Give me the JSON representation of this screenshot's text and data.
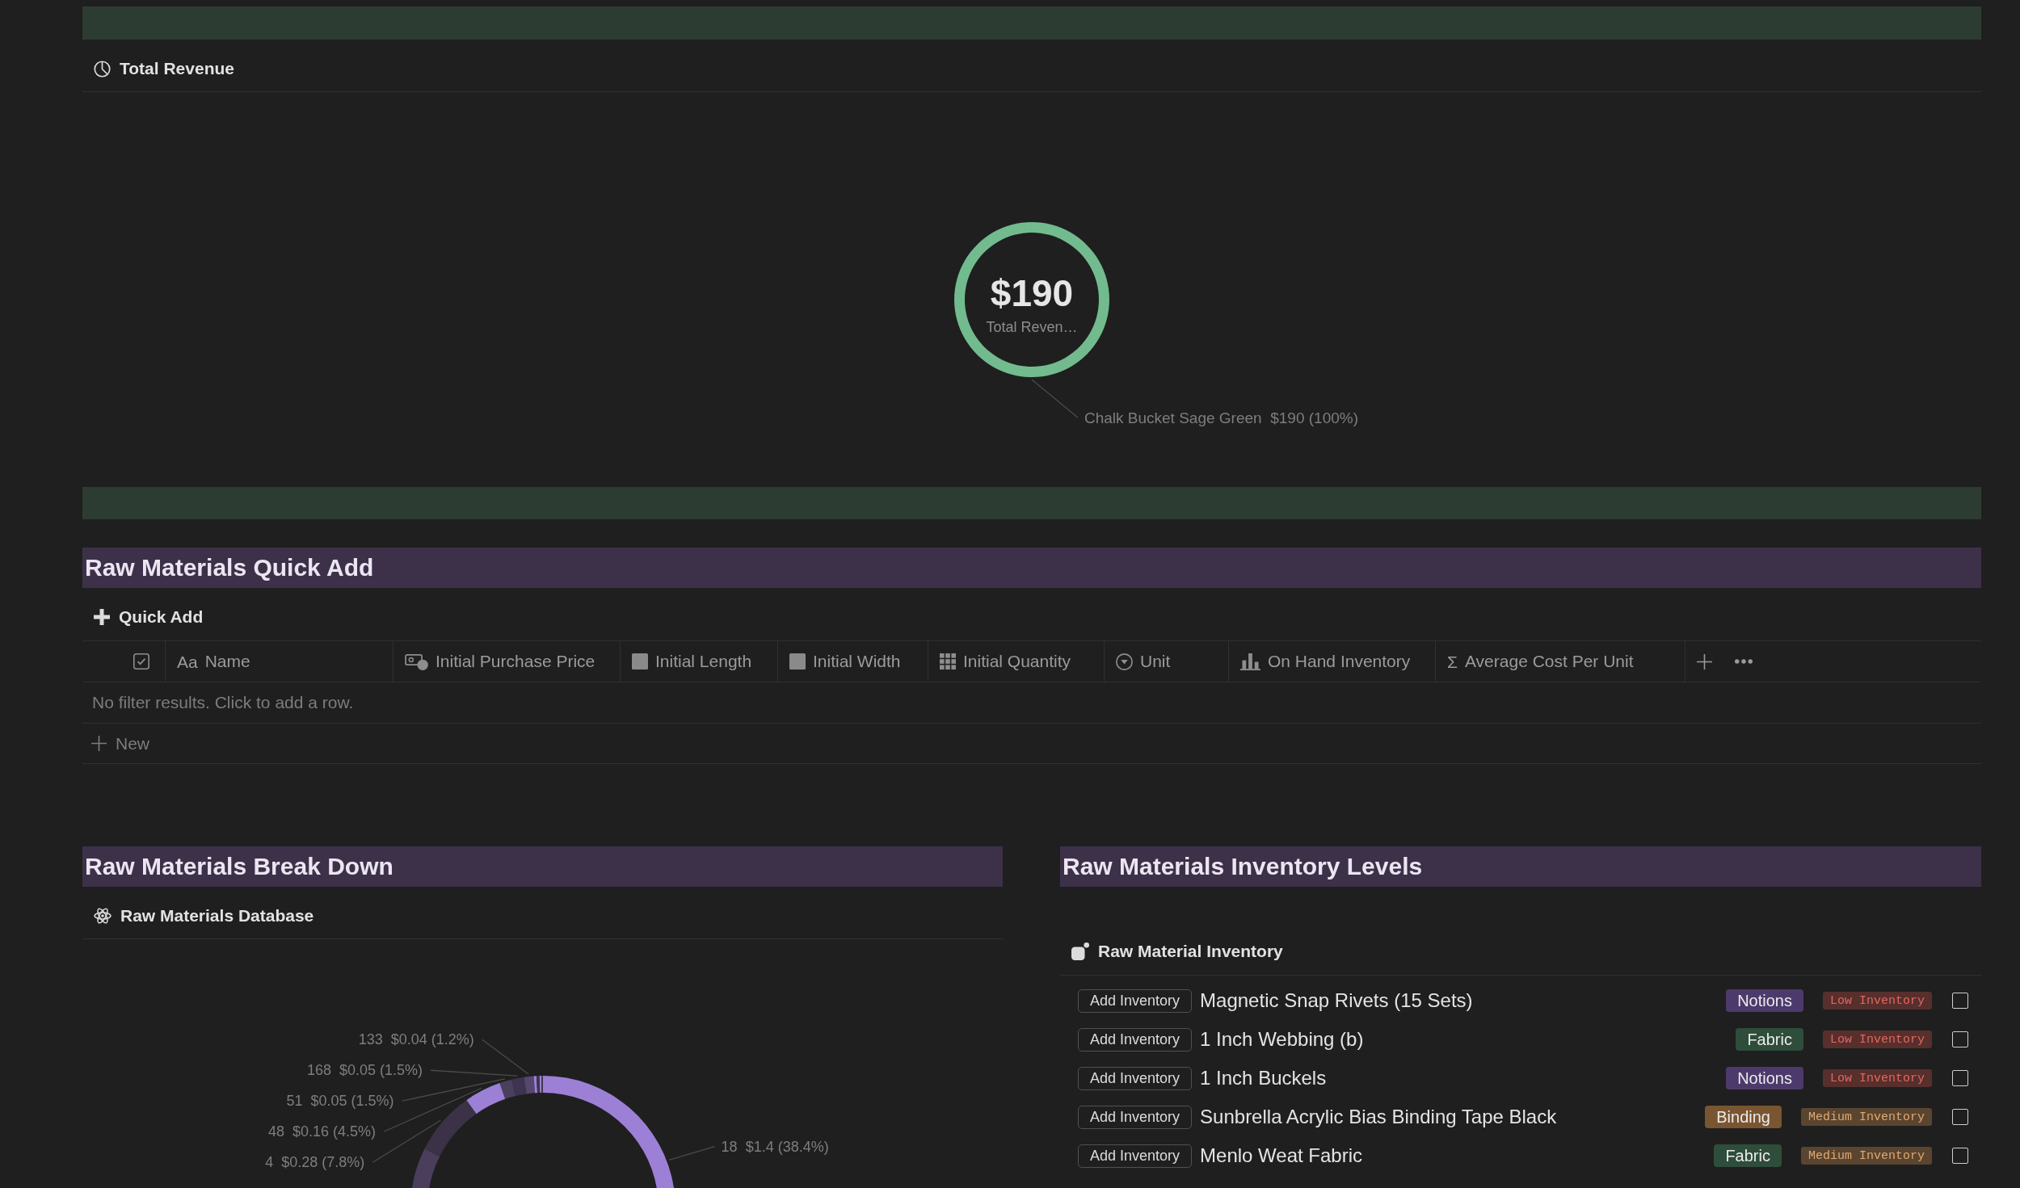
{
  "revenue_view": {
    "view_tab": "Total Revenue",
    "slice_label": {
      "category": "Chalk Bucket Sage Green",
      "value": "$190 (100%)"
    },
    "center_value": "$190",
    "center_label": "Total Reven…"
  },
  "quick_add": {
    "heading": "Raw Materials Quick Add",
    "view_tab": "Quick Add",
    "table": {
      "columns": [
        {
          "kind": "checkbox"
        },
        {
          "kind": "title",
          "glyph": "Aa",
          "label": "Name"
        },
        {
          "kind": "money",
          "label": "Initial Purchase Price"
        },
        {
          "kind": "square",
          "label": "Initial Length"
        },
        {
          "kind": "square",
          "label": "Initial Width"
        },
        {
          "kind": "grid",
          "label": "Initial Quantity"
        },
        {
          "kind": "select",
          "label": "Unit"
        },
        {
          "kind": "rollup",
          "label": "On Hand Inventory"
        },
        {
          "kind": "formula",
          "glyph": "Σ",
          "label": "Average Cost Per Unit"
        }
      ],
      "empty_message": "No filter results. Click to add a row.",
      "new_row": "New"
    }
  },
  "breakdown": {
    "heading": "Raw Materials Break Down",
    "view_tab": "Raw Materials Database",
    "slice_labels": [
      {
        "category": "133",
        "value": "$0.04 (1.2%)"
      },
      {
        "category": "168",
        "value": "$0.05 (1.5%)"
      },
      {
        "category": "51",
        "value": "$0.05 (1.5%)"
      },
      {
        "category": "48",
        "value": "$0.16 (4.5%)"
      },
      {
        "category": "18",
        "value": "$1.4 (38.4%)"
      },
      {
        "category": "4",
        "value": "$0.28 (7.8%)"
      }
    ]
  },
  "inventory": {
    "heading": "Raw Materials Inventory Levels",
    "view_tab": "Raw Material Inventory",
    "rows": [
      {
        "button": "Add Inventory",
        "name": "Magnetic Snap Rivets (15 Sets)",
        "category": {
          "label": "Notions",
          "color": "#4c3a6c"
        },
        "status": {
          "label": "Low Inventory",
          "color": "#572f2c"
        },
        "checked": false
      },
      {
        "button": "Add Inventory",
        "name": "1 Inch Webbing (b)",
        "category": {
          "label": "Fabric",
          "color": "#2e4d3a"
        },
        "status": {
          "label": "Low Inventory",
          "color": "#572f2c"
        },
        "checked": false
      },
      {
        "button": "Add Inventory",
        "name": "1 Inch Buckels",
        "category": {
          "label": "Notions",
          "color": "#4c3a6c"
        },
        "status": {
          "label": "Low Inventory",
          "color": "#572f2c"
        },
        "checked": false
      },
      {
        "button": "Add Inventory",
        "name": "Sunbrella Acrylic Bias Binding Tape Black",
        "category": {
          "label": "Binding",
          "color": "#7a5531"
        },
        "status": {
          "label": "Medium Inventory",
          "color": "#5a4530"
        },
        "checked": false
      },
      {
        "button": "Add Inventory",
        "name": "Menlo Weat Fabric",
        "category": {
          "label": "Fabric",
          "color": "#2e4d3a"
        },
        "status": {
          "label": "Medium Inventory",
          "color": "#5a4530"
        },
        "checked": false
      }
    ]
  }
}
